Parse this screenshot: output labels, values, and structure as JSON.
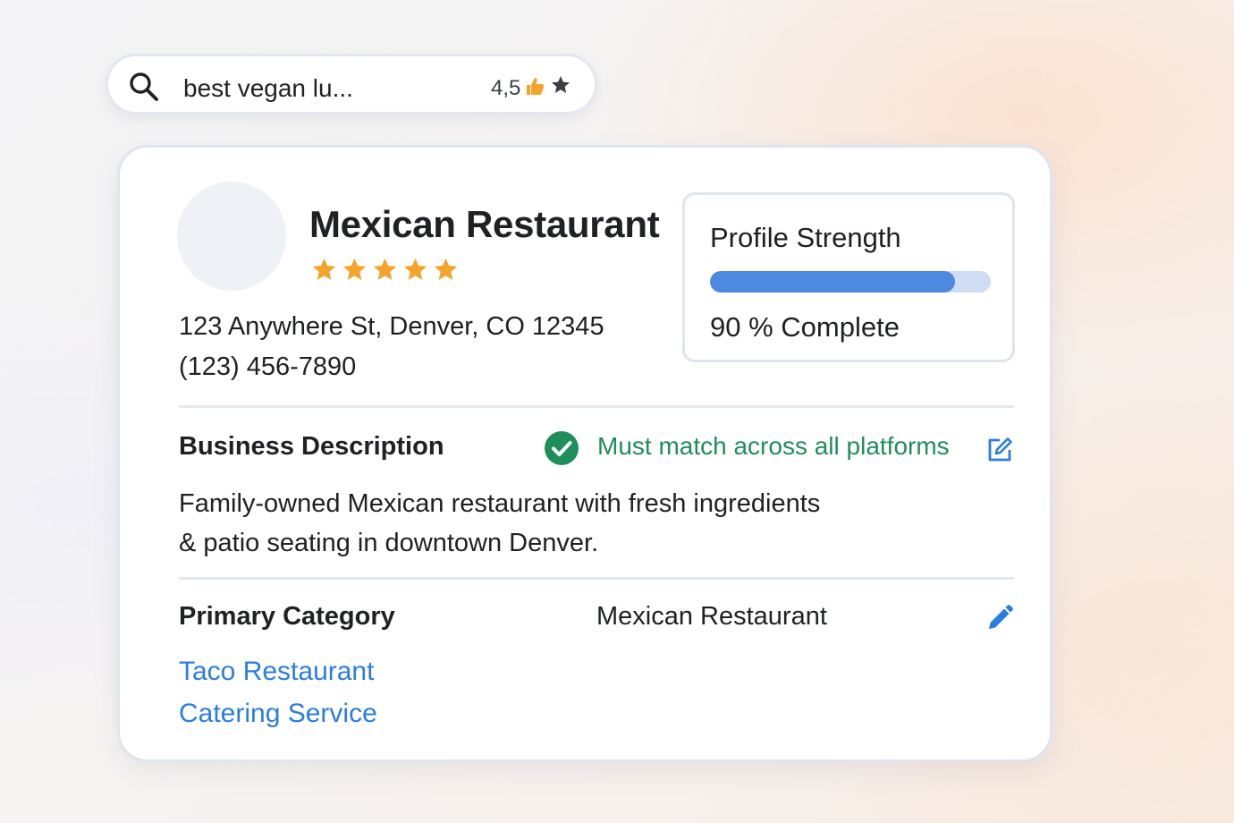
{
  "search": {
    "query": "best vegan lu...",
    "rating": "4,5",
    "icons": [
      "search-icon",
      "thumbs-up-icon",
      "star-icon"
    ]
  },
  "business": {
    "name": "Mexican Restaurant",
    "star_rating": 5,
    "address": "123 Anywhere St, Denver,  CO 12345",
    "phone": "(123)  456-7890"
  },
  "profile_strength": {
    "title": "Profile Strength",
    "percent": 90,
    "label": "90 % Complete"
  },
  "description": {
    "label": "Business Description",
    "status": "Must match across all  platforms",
    "lines": [
      "Family-owned Mexican restaurant with fresh ingredients",
      "& patio seating in downtown Denver."
    ]
  },
  "category": {
    "label": "Primary Category",
    "value": "Mexican Restaurant",
    "additional": [
      "Taco Restaurant",
      "Catering Service"
    ]
  },
  "colors": {
    "star": "#f4a32b",
    "progress": "#4d89e0",
    "success": "#1e8e5a",
    "link": "#2a7de1"
  }
}
